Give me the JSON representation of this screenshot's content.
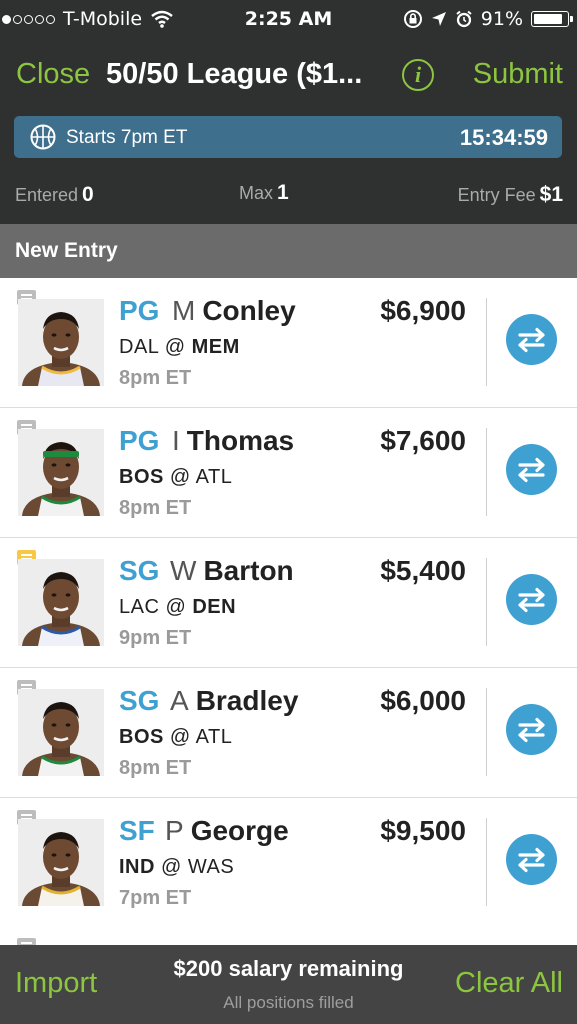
{
  "status_bar": {
    "carrier": "T-Mobile",
    "time": "2:25 AM",
    "battery": "91%",
    "battery_level": 0.91
  },
  "nav": {
    "close_label": "Close",
    "title": "50/50 League ($1...",
    "info_icon": "info-icon",
    "submit_label": "Submit"
  },
  "banner": {
    "start_text": "Starts 7pm ET",
    "timer": "15:34:59",
    "icon": "basketball-icon"
  },
  "stats": {
    "entered_label": "Entered",
    "entered_value": "0",
    "max_label": "Max",
    "max_value": "1",
    "fee_label": "Entry Fee",
    "fee_value": "$1"
  },
  "section_header": "New Entry",
  "players": [
    {
      "pos": "PG",
      "initial": "M",
      "last": "Conley",
      "salary": "$6,900",
      "away": "DAL",
      "home": "MEM",
      "bold_team": "home",
      "time": "8pm ET",
      "note_color": "#bdbdbd",
      "jersey_color": "#e8e8f2",
      "trim_color": "#f0b940",
      "headband": false
    },
    {
      "pos": "PG",
      "initial": "I",
      "last": "Thomas",
      "salary": "$7,600",
      "away": "BOS",
      "home": "ATL",
      "bold_team": "away",
      "time": "8pm ET",
      "note_color": "#bdbdbd",
      "jersey_color": "#f2f2f2",
      "trim_color": "#1e8a3e",
      "headband": true
    },
    {
      "pos": "SG",
      "initial": "W",
      "last": "Barton",
      "salary": "$5,400",
      "away": "LAC",
      "home": "DEN",
      "bold_team": "home",
      "time": "9pm ET",
      "note_color": "#f6c845",
      "jersey_color": "#eef2f8",
      "trim_color": "#2a5aa8",
      "headband": false
    },
    {
      "pos": "SG",
      "initial": "A",
      "last": "Bradley",
      "salary": "$6,000",
      "away": "BOS",
      "home": "ATL",
      "bold_team": "away",
      "time": "8pm ET",
      "note_color": "#bdbdbd",
      "jersey_color": "#f2f2f2",
      "trim_color": "#1e8a3e",
      "headband": false
    },
    {
      "pos": "SF",
      "initial": "P",
      "last": "George",
      "salary": "$9,500",
      "away": "IND",
      "home": "WAS",
      "bold_team": "away",
      "time": "7pm ET",
      "note_color": "#bdbdbd",
      "jersey_color": "#f4f2ea",
      "trim_color": "#e0b230",
      "headband": false
    }
  ],
  "bottom": {
    "import_label": "Import",
    "salary_text": "$200 salary remaining",
    "sub_text": "All positions filled",
    "clear_label": "Clear All"
  },
  "colors": {
    "accent_green": "#8cc63f",
    "position_blue": "#3fa0d2",
    "banner_blue": "#3e6f8d",
    "dark_bg": "#2f3030",
    "section_gray": "#6b6b6b"
  }
}
